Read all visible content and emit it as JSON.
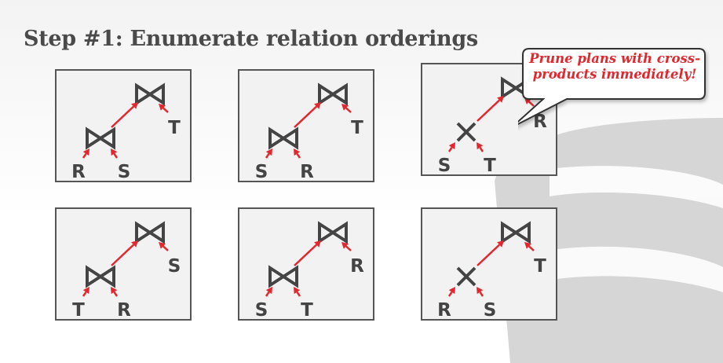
{
  "title": "Step #1: Enumerate relation orderings",
  "callout": {
    "line1": "Prune plans with cross-",
    "line2": "products immediately!"
  },
  "colors": {
    "edge": "#e0282e",
    "symbol": "#444444",
    "box_border": "#555555"
  },
  "plans": [
    {
      "top_op": "join",
      "bottom_op": "join",
      "leaf_left": "R",
      "leaf_right": "S",
      "top_leaf": "T"
    },
    {
      "top_op": "join",
      "bottom_op": "join",
      "leaf_left": "S",
      "leaf_right": "R",
      "top_leaf": "T"
    },
    {
      "top_op": "join",
      "bottom_op": "cross",
      "leaf_left": "S",
      "leaf_right": "T",
      "top_leaf": "R"
    },
    {
      "top_op": "join",
      "bottom_op": "join",
      "leaf_left": "T",
      "leaf_right": "R",
      "top_leaf": "S"
    },
    {
      "top_op": "join",
      "bottom_op": "join",
      "leaf_left": "S",
      "leaf_right": "T",
      "top_leaf": "R"
    },
    {
      "top_op": "join",
      "bottom_op": "cross",
      "leaf_left": "R",
      "leaf_right": "S",
      "top_leaf": "T"
    }
  ]
}
